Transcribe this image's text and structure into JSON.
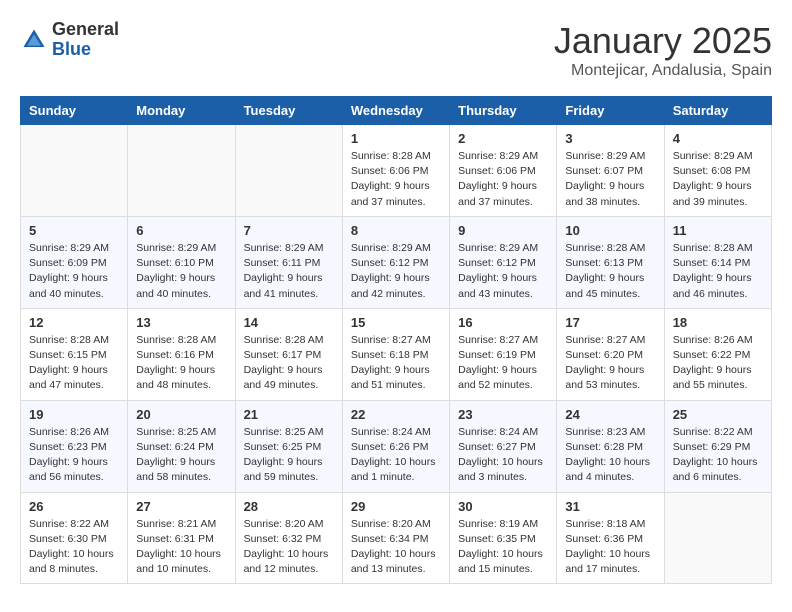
{
  "logo": {
    "general": "General",
    "blue": "Blue"
  },
  "title": "January 2025",
  "location": "Montejicar, Andalusia, Spain",
  "weekdays": [
    "Sunday",
    "Monday",
    "Tuesday",
    "Wednesday",
    "Thursday",
    "Friday",
    "Saturday"
  ],
  "weeks": [
    [
      {
        "day": "",
        "info": ""
      },
      {
        "day": "",
        "info": ""
      },
      {
        "day": "",
        "info": ""
      },
      {
        "day": "1",
        "info": "Sunrise: 8:28 AM\nSunset: 6:06 PM\nDaylight: 9 hours and 37 minutes."
      },
      {
        "day": "2",
        "info": "Sunrise: 8:29 AM\nSunset: 6:06 PM\nDaylight: 9 hours and 37 minutes."
      },
      {
        "day": "3",
        "info": "Sunrise: 8:29 AM\nSunset: 6:07 PM\nDaylight: 9 hours and 38 minutes."
      },
      {
        "day": "4",
        "info": "Sunrise: 8:29 AM\nSunset: 6:08 PM\nDaylight: 9 hours and 39 minutes."
      }
    ],
    [
      {
        "day": "5",
        "info": "Sunrise: 8:29 AM\nSunset: 6:09 PM\nDaylight: 9 hours and 40 minutes."
      },
      {
        "day": "6",
        "info": "Sunrise: 8:29 AM\nSunset: 6:10 PM\nDaylight: 9 hours and 40 minutes."
      },
      {
        "day": "7",
        "info": "Sunrise: 8:29 AM\nSunset: 6:11 PM\nDaylight: 9 hours and 41 minutes."
      },
      {
        "day": "8",
        "info": "Sunrise: 8:29 AM\nSunset: 6:12 PM\nDaylight: 9 hours and 42 minutes."
      },
      {
        "day": "9",
        "info": "Sunrise: 8:29 AM\nSunset: 6:12 PM\nDaylight: 9 hours and 43 minutes."
      },
      {
        "day": "10",
        "info": "Sunrise: 8:28 AM\nSunset: 6:13 PM\nDaylight: 9 hours and 45 minutes."
      },
      {
        "day": "11",
        "info": "Sunrise: 8:28 AM\nSunset: 6:14 PM\nDaylight: 9 hours and 46 minutes."
      }
    ],
    [
      {
        "day": "12",
        "info": "Sunrise: 8:28 AM\nSunset: 6:15 PM\nDaylight: 9 hours and 47 minutes."
      },
      {
        "day": "13",
        "info": "Sunrise: 8:28 AM\nSunset: 6:16 PM\nDaylight: 9 hours and 48 minutes."
      },
      {
        "day": "14",
        "info": "Sunrise: 8:28 AM\nSunset: 6:17 PM\nDaylight: 9 hours and 49 minutes."
      },
      {
        "day": "15",
        "info": "Sunrise: 8:27 AM\nSunset: 6:18 PM\nDaylight: 9 hours and 51 minutes."
      },
      {
        "day": "16",
        "info": "Sunrise: 8:27 AM\nSunset: 6:19 PM\nDaylight: 9 hours and 52 minutes."
      },
      {
        "day": "17",
        "info": "Sunrise: 8:27 AM\nSunset: 6:20 PM\nDaylight: 9 hours and 53 minutes."
      },
      {
        "day": "18",
        "info": "Sunrise: 8:26 AM\nSunset: 6:22 PM\nDaylight: 9 hours and 55 minutes."
      }
    ],
    [
      {
        "day": "19",
        "info": "Sunrise: 8:26 AM\nSunset: 6:23 PM\nDaylight: 9 hours and 56 minutes."
      },
      {
        "day": "20",
        "info": "Sunrise: 8:25 AM\nSunset: 6:24 PM\nDaylight: 9 hours and 58 minutes."
      },
      {
        "day": "21",
        "info": "Sunrise: 8:25 AM\nSunset: 6:25 PM\nDaylight: 9 hours and 59 minutes."
      },
      {
        "day": "22",
        "info": "Sunrise: 8:24 AM\nSunset: 6:26 PM\nDaylight: 10 hours and 1 minute."
      },
      {
        "day": "23",
        "info": "Sunrise: 8:24 AM\nSunset: 6:27 PM\nDaylight: 10 hours and 3 minutes."
      },
      {
        "day": "24",
        "info": "Sunrise: 8:23 AM\nSunset: 6:28 PM\nDaylight: 10 hours and 4 minutes."
      },
      {
        "day": "25",
        "info": "Sunrise: 8:22 AM\nSunset: 6:29 PM\nDaylight: 10 hours and 6 minutes."
      }
    ],
    [
      {
        "day": "26",
        "info": "Sunrise: 8:22 AM\nSunset: 6:30 PM\nDaylight: 10 hours and 8 minutes."
      },
      {
        "day": "27",
        "info": "Sunrise: 8:21 AM\nSunset: 6:31 PM\nDaylight: 10 hours and 10 minutes."
      },
      {
        "day": "28",
        "info": "Sunrise: 8:20 AM\nSunset: 6:32 PM\nDaylight: 10 hours and 12 minutes."
      },
      {
        "day": "29",
        "info": "Sunrise: 8:20 AM\nSunset: 6:34 PM\nDaylight: 10 hours and 13 minutes."
      },
      {
        "day": "30",
        "info": "Sunrise: 8:19 AM\nSunset: 6:35 PM\nDaylight: 10 hours and 15 minutes."
      },
      {
        "day": "31",
        "info": "Sunrise: 8:18 AM\nSunset: 6:36 PM\nDaylight: 10 hours and 17 minutes."
      },
      {
        "day": "",
        "info": ""
      }
    ]
  ]
}
